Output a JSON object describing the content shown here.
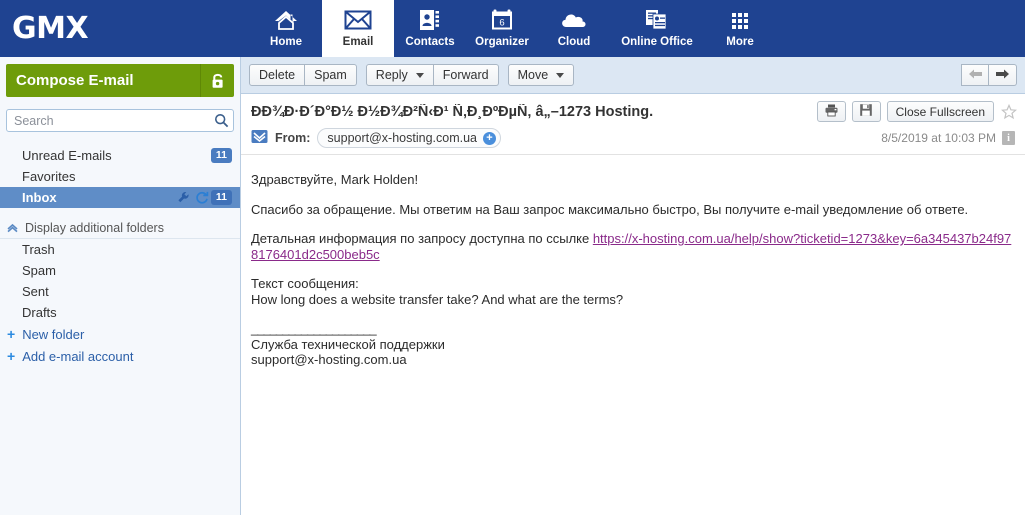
{
  "brand": {
    "logo": "GMX",
    "header_color": "#1f4391",
    "compose_color": "#6e9c0a",
    "selected_folder_color": "#5f8dc7",
    "link_color": "#8a2a8a"
  },
  "nav": {
    "items": [
      {
        "label": "Home",
        "icon": "home-icon",
        "active": false
      },
      {
        "label": "Email",
        "icon": "envelope-icon",
        "active": true
      },
      {
        "label": "Contacts",
        "icon": "contacts-icon",
        "active": false
      },
      {
        "label": "Organizer",
        "icon": "calendar-icon",
        "active": false,
        "calendar_day": "6"
      },
      {
        "label": "Cloud",
        "icon": "cloud-icon",
        "active": false
      },
      {
        "label": "Online Office",
        "icon": "documents-icon",
        "active": false
      },
      {
        "label": "More",
        "icon": "grid-dots-icon",
        "active": false
      }
    ]
  },
  "sidebar": {
    "compose_label": "Compose E-mail",
    "compose_lock_icon": "lock-icon",
    "search": {
      "placeholder": "Search",
      "value": "",
      "icon": "search-icon"
    },
    "folders": [
      {
        "label": "Unread E-mails",
        "badge": "11",
        "selected": false
      },
      {
        "label": "Favorites",
        "badge": "",
        "selected": false
      },
      {
        "label": "Inbox",
        "badge": "11",
        "selected": true,
        "icons": [
          "wrench-icon",
          "refresh-icon"
        ]
      }
    ],
    "additional_folders_label": "Display additional folders",
    "additional_folders": [
      {
        "label": "Trash"
      },
      {
        "label": "Spam"
      },
      {
        "label": "Sent"
      },
      {
        "label": "Drafts"
      }
    ],
    "actions": [
      {
        "label": "New folder"
      },
      {
        "label": "Add e-mail account"
      }
    ]
  },
  "toolbar": {
    "delete_label": "Delete",
    "spam_label": "Spam",
    "reply_label": "Reply",
    "forward_label": "Forward",
    "move_label": "Move",
    "prev_icon": "arrow-left-icon",
    "next_icon": "arrow-right-icon"
  },
  "message": {
    "subject": "ÐÐ¾Ð·Ð´Ð°Ð½ Ð½Ð¾Ð²Ñ‹Ð¹ Ñ‚Ð¸ÐºÐµÑ‚ â„–1273 Hosting.",
    "print_icon": "printer-icon",
    "save_icon": "floppy-save-icon",
    "fullscreen_label": "Close Fullscreen",
    "star_icon": "star-outline-icon",
    "envelope_icon": "envelope-open-icon",
    "from_label": "From:",
    "from_address": "support@x-hosting.com.ua",
    "add_contact_icon": "plus-circle-icon",
    "date": "8/5/2019 at 10:03 PM",
    "info_icon": "info-icon",
    "body": {
      "greeting": "Здравствуйте, Mark Holden!",
      "paragraph1": "Спасибо за обращение. Мы ответим на Ваш запрос максимально быстро, Вы получите e-mail уведомление об ответе.",
      "paragraph2_prefix": "Детальная информация по запросу доступна по ссылке ",
      "link_text": "https://x-hosting.com.ua/help/show?ticketid=1273&key=6a345437b24f978176401d2c500beb5c",
      "message_label": "Текст сообщения:",
      "message_text": "How long does a website transfer take? And what are the terms?",
      "separator": "____________________",
      "signature_line1": "Служба технической поддержки",
      "signature_line2": "support@x-hosting.com.ua"
    }
  }
}
